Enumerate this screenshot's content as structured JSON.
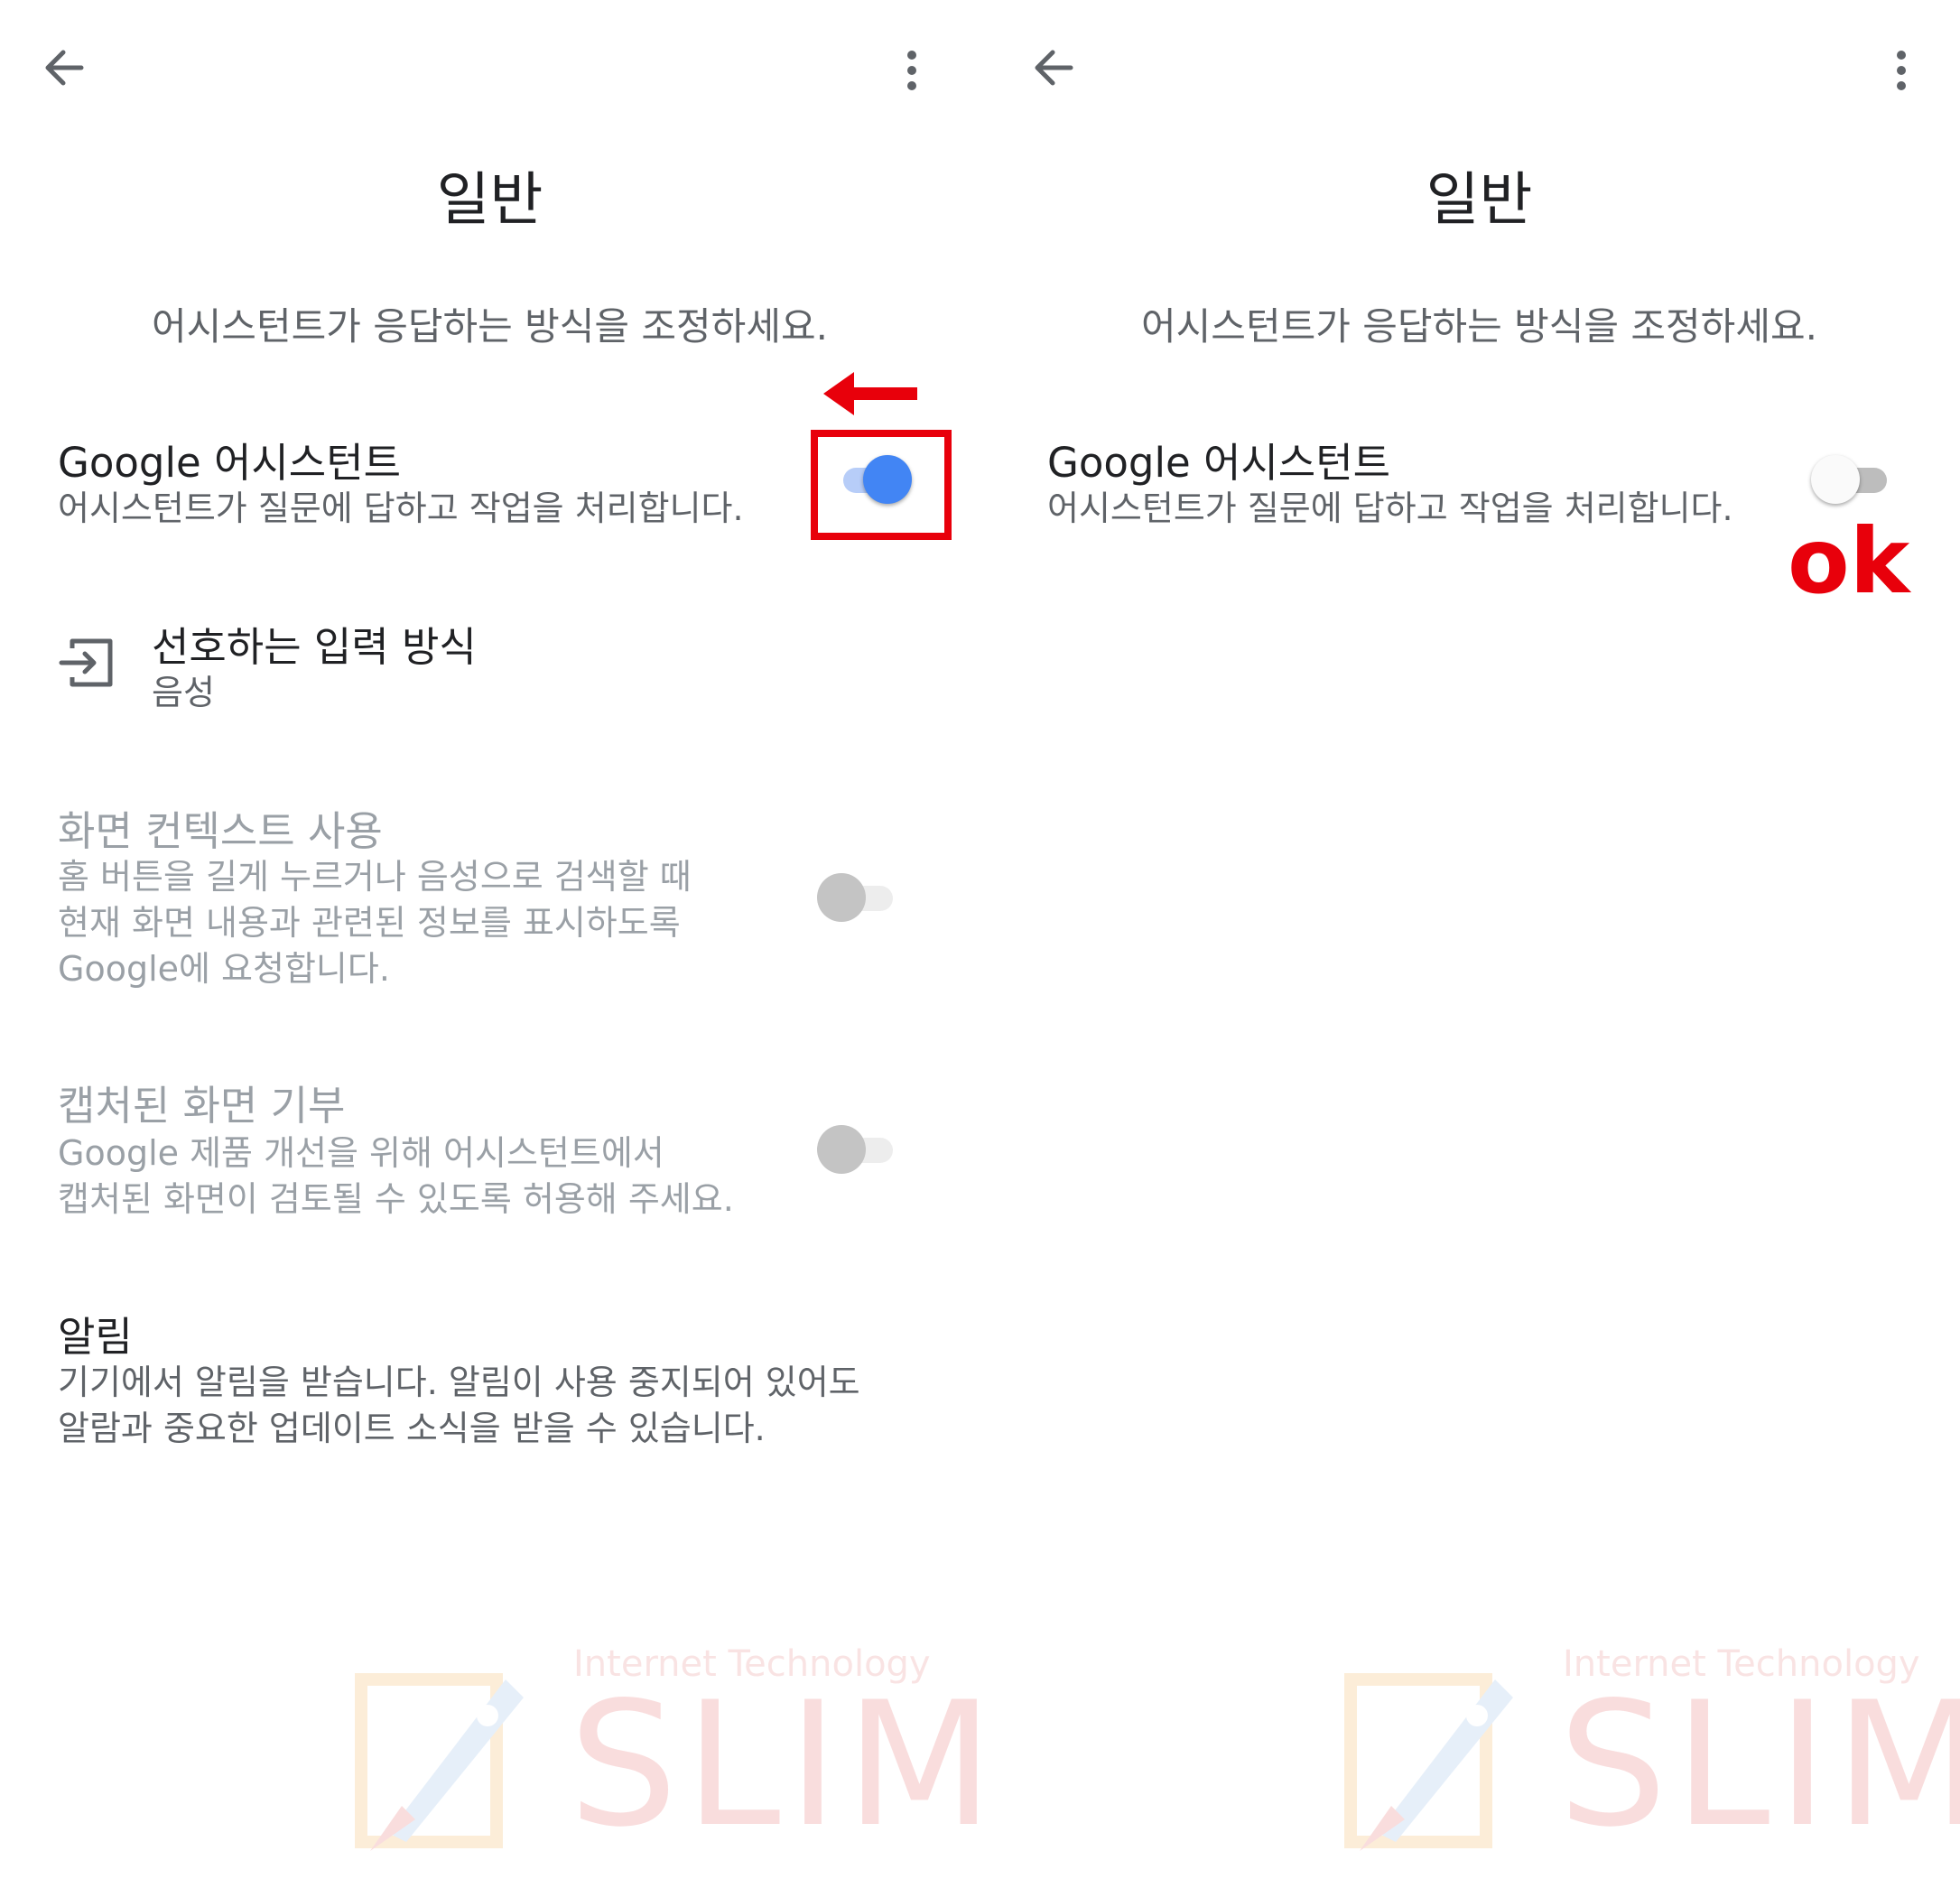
{
  "colors": {
    "accent": "#4285f4",
    "annotation_red": "#e8000b",
    "secondary_text": "#5f6368",
    "disabled_text": "#9aa0a6"
  },
  "left": {
    "title": "일반",
    "subtitle": "어시스턴트가 응답하는 방식을 조정하세요.",
    "assistant": {
      "title": "Google 어시스턴트",
      "desc": "어시스턴트가 질문에 답하고 작업을 처리합니다.",
      "toggle": "on"
    },
    "input_method": {
      "title": "선호하는 입력 방식",
      "value": "음성",
      "icon": "input-icon"
    },
    "screen_context": {
      "title": "화면 컨텍스트 사용",
      "desc_lines": [
        "홈 버튼을 길게 누르거나 음성으로 검색할 때",
        "현재 화면 내용과 관련된 정보를 표시하도록",
        "Google에 요청합니다."
      ],
      "toggle": "off-disabled"
    },
    "screenshot_donate": {
      "title": "캡처된 화면 기부",
      "desc_lines": [
        "Google 제품 개선을 위해 어시스턴트에서",
        "캡처된 화면이 검토될 수 있도록 허용해 주세요."
      ],
      "toggle": "off-disabled"
    },
    "notifications": {
      "title": "알림",
      "desc_lines": [
        "기기에서 알림을 받습니다. 알림이 사용 중지되어 있어도",
        "알람과 중요한 업데이트 소식을 받을 수 있습니다."
      ]
    },
    "annotation": {
      "arrow": "left-arrow",
      "box": "highlight-box"
    }
  },
  "right": {
    "title": "일반",
    "subtitle": "어시스턴트가 응답하는 방식을 조정하세요.",
    "assistant": {
      "title": "Google 어시스턴트",
      "desc": "어시스턴트가 질문에 답하고 작업을 처리합니다.",
      "toggle": "off"
    },
    "annotation": {
      "label": "ok"
    }
  },
  "watermark": {
    "tagline": "Internet Technology",
    "name": "SLIM"
  }
}
